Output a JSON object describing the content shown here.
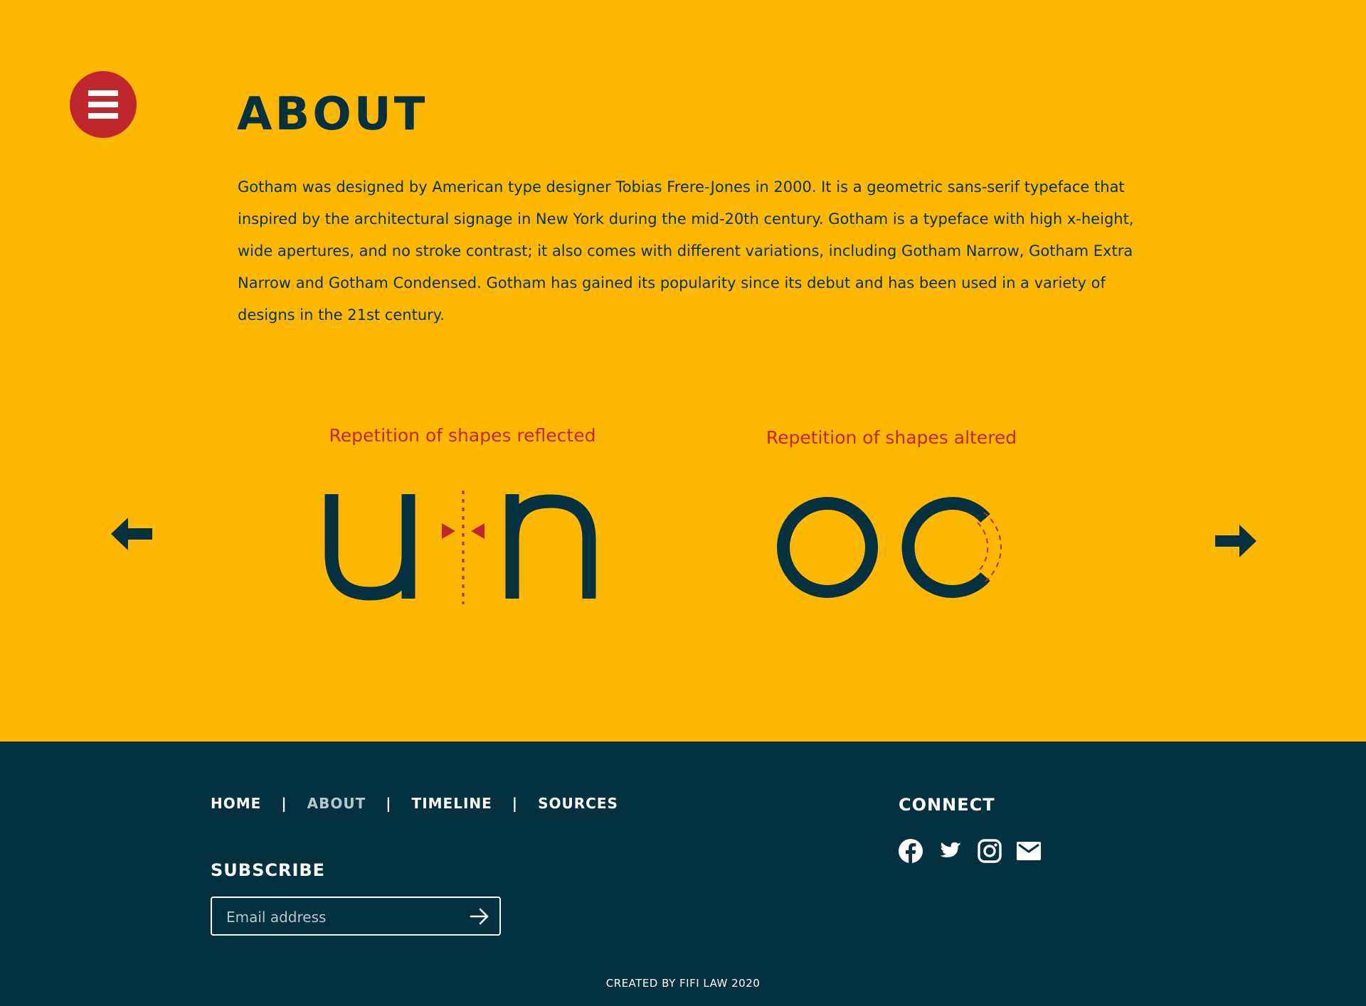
{
  "about": {
    "title": "ABOUT",
    "paragraph": "Gotham was designed by American type designer Tobias Frere-Jones in 2000. It is a geometric sans-serif typeface that inspired by the architectural signage in New York during the mid-20th century. Gotham is a typeface with high x-height, wide apertures, and no stroke contrast; it also comes with different variations, including Gotham Narrow, Gotham Extra Narrow and Gotham Condensed. Gotham has gained its popularity since its debut and has been used in a variety of designs in the 21st century."
  },
  "carousel": {
    "slides": [
      {
        "caption": "Repetition of shapes reflected",
        "glyphs": "u n"
      },
      {
        "caption": "Repetition of shapes altered",
        "glyphs": "o c"
      }
    ]
  },
  "footer": {
    "nav": [
      {
        "label": "HOME",
        "active": false
      },
      {
        "label": "ABOUT",
        "active": true
      },
      {
        "label": "TIMELINE",
        "active": false
      },
      {
        "label": "SOURCES",
        "active": false
      }
    ],
    "nav_separator": "|",
    "subscribe": {
      "heading": "SUBSCRIBE",
      "placeholder": "Email address"
    },
    "connect": {
      "heading": "CONNECT",
      "icons": [
        "facebook-icon",
        "twitter-icon",
        "instagram-icon",
        "mail-icon"
      ]
    },
    "credit": "CREATED BY FIFI LAW 2020"
  },
  "colors": {
    "background": "#FFB800",
    "navy": "#043140",
    "accent_red": "#C0272D",
    "muted_text": "#B8C7CC",
    "white": "#FFFFFF"
  }
}
